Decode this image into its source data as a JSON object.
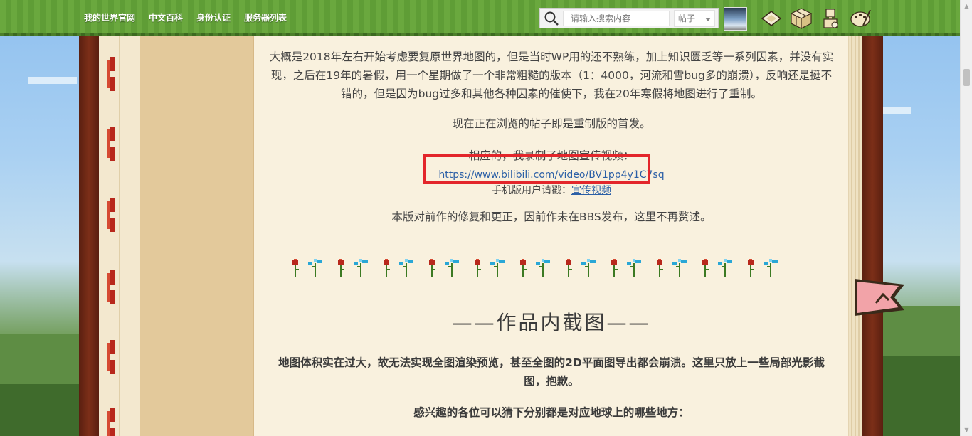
{
  "nav": {
    "items": [
      {
        "label": "我的世界官网"
      },
      {
        "label": "中文百科"
      },
      {
        "label": "身份认证"
      },
      {
        "label": "服务器列表"
      }
    ]
  },
  "search": {
    "placeholder": "请输入搜索内容",
    "type_selected": "帖子"
  },
  "post": {
    "para1": "大概是2018年左右开始考虑要复原世界地图的，但是当时WP用的还不熟练，加上知识匮乏等一系列因素，并没有实现，之后在19年的暑假，用一个星期做了一个非常粗糙的版本（1：4000，河流和雪bug多的崩溃），反响还是挺不错的，但是因为bug过多和其他各种因素的催使下，我在20年寒假将地图进行了重制。",
    "para2": "现在正在浏览的帖子即是重制版的首发。",
    "para3_line1": "相应的，我录制了地图宣传视频：",
    "video_link": "https://www.bilibili.com/video/BV1pp4y1C7sq",
    "mobile_prefix": "手机版用户请戳：",
    "mobile_link": "宣传视频",
    "para4": "本版对前作的修复和更正，因前作未在BBS发布，这里不再赘述。",
    "heading": "——作品内截图——",
    "para5": "地图体积实在过大，故无法实现全图渲染预览，甚至全图的2D平面图导出都会崩溃。这里只放上一些局部光影截图，抱歉。",
    "para6": "感兴趣的各位可以猜下分别都是对应地球上的哪些地方："
  },
  "icons": {
    "search": "search-icon",
    "dropdown": "chevron-down-icon",
    "message": "envelope-icon",
    "notice": "crafting-table-icon",
    "profile": "villager-icon",
    "settings": "palette-icon",
    "bookmark": "bookmark-icon"
  },
  "colors": {
    "topbar": "#6aa83e",
    "highlight": "#e3262b",
    "link": "#2b5fa6",
    "page": "#f9f1de"
  }
}
